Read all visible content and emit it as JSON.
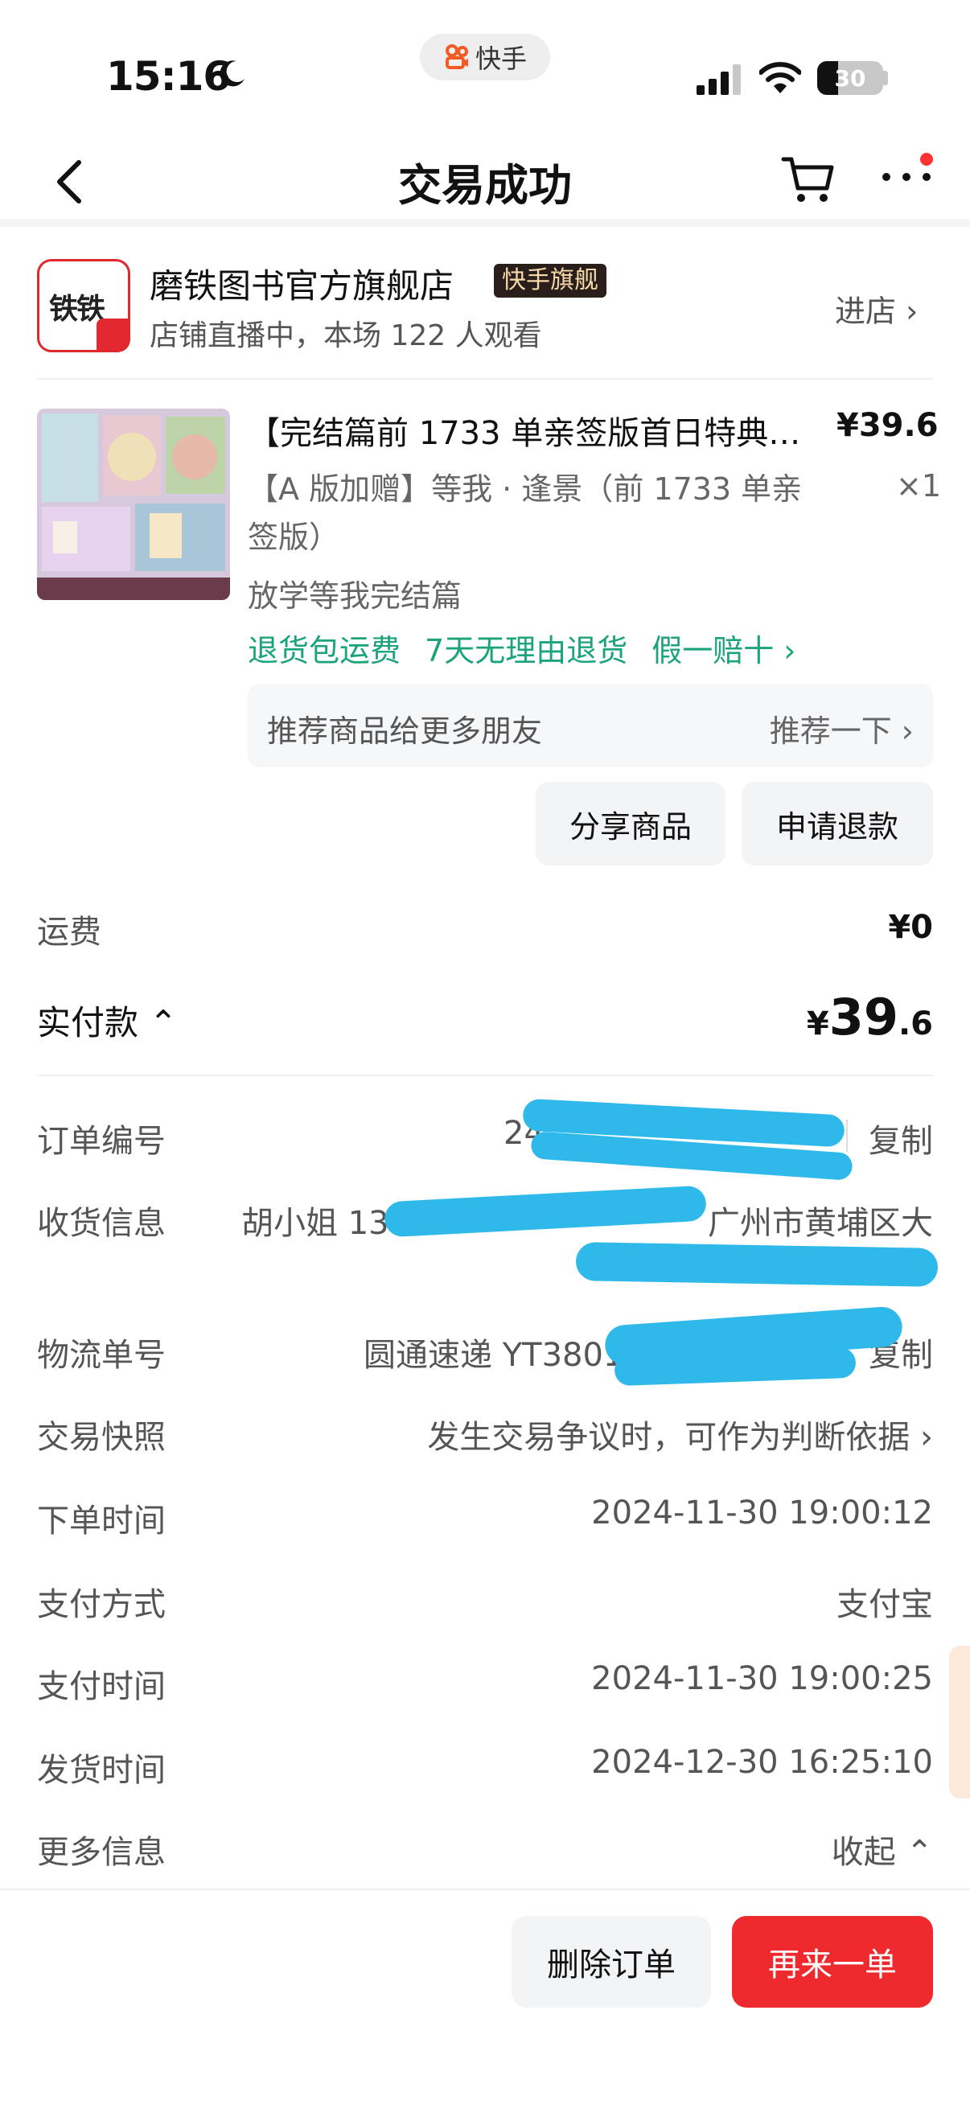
{
  "status_bar": {
    "time": "15:16",
    "app_pill": "快手",
    "battery": "30"
  },
  "nav": {
    "title": "交易成功"
  },
  "shop": {
    "logo_text": "铁铁",
    "name": "磨铁图书官方旗舰店",
    "badge": "快手旗舰",
    "subtitle": "店铺直播中，本场 122 人观看",
    "enter_label": "进店 ›"
  },
  "product": {
    "title": "【完结篇前 1733 单亲签版首日特典…",
    "price": "¥39.6",
    "variant": "【A 版加赠】等我 · 逢景（前 1733 单亲签版）",
    "quantity": "×1",
    "series": "放学等我完结篇",
    "tags": [
      "退货包运费",
      "7天无理由退货",
      "假一赔十 ›"
    ],
    "recommend_left": "推荐商品给更多朋友",
    "recommend_right": "推荐一下 ›",
    "share_button": "分享商品",
    "refund_button": "申请退款"
  },
  "fees": {
    "shipping_label": "运费",
    "shipping_value": "¥0",
    "paid_label": "实付款 ⌃",
    "paid_currency": "¥",
    "paid_integer": "39",
    "paid_decimal": ".6"
  },
  "details": [
    {
      "label": "订单编号",
      "value": "24",
      "action": "复制"
    },
    {
      "label": "收货信息",
      "value": "胡小姐 137",
      "value2": "广州市黄埔区大"
    },
    {
      "label": "物流单号",
      "value": "圆通速递 YT3801",
      "action": "复制"
    },
    {
      "label": "交易快照",
      "value": "发生交易争议时，可作为判断依据 ›"
    },
    {
      "label": "下单时间",
      "value": "2024-11-30 19:00:12"
    },
    {
      "label": "支付方式",
      "value": "支付宝"
    },
    {
      "label": "支付时间",
      "value": "2024-11-30 19:00:25"
    },
    {
      "label": "发货时间",
      "value": "2024-12-30 16:25:10"
    },
    {
      "label": "更多信息",
      "value": "收起 ⌃"
    }
  ],
  "bottom": {
    "delete_button": "删除订单",
    "again_button": "再来一单"
  },
  "colors": {
    "accent_red": "#ee2a2f",
    "tag_green": "#1ba37a",
    "redact_blue": "#2fb9ea"
  }
}
